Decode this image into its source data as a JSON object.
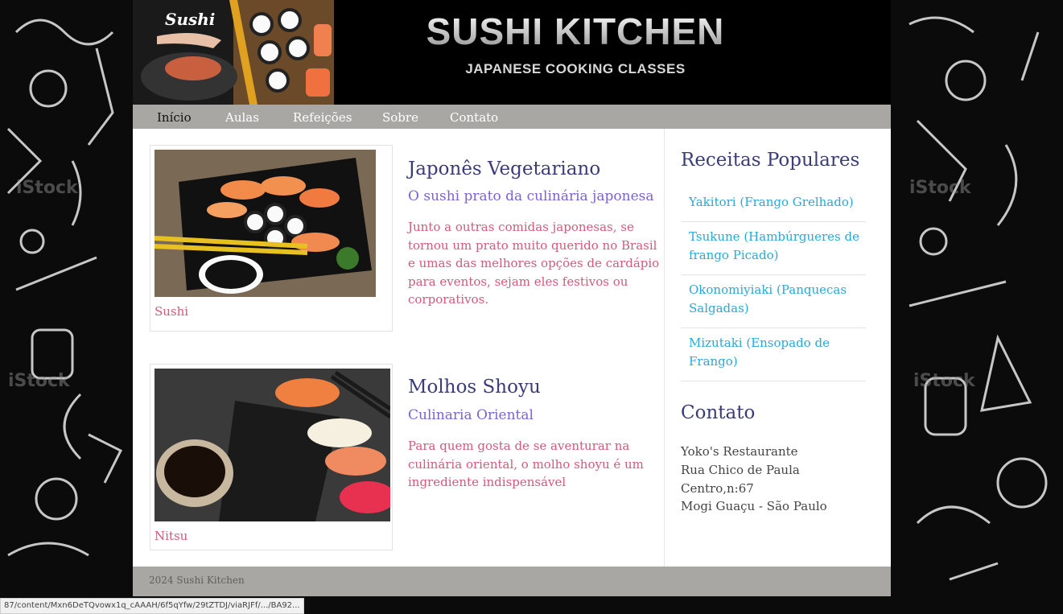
{
  "header": {
    "logo_text": "Sushi",
    "title": "SUSHI KITCHEN",
    "subtitle": "JAPANESE COOKING CLASSES"
  },
  "nav": {
    "items": [
      {
        "label": "Início",
        "active": true
      },
      {
        "label": "Aulas",
        "active": false
      },
      {
        "label": "Refeições",
        "active": false
      },
      {
        "label": "Sobre",
        "active": false
      },
      {
        "label": "Contato",
        "active": false
      }
    ]
  },
  "articles": [
    {
      "caption": "Sushi",
      "title": "Japonês Vegetariano",
      "subtitle": "O sushi prato da culinária japonesa",
      "body": "Junto a outras comidas japonesas, se tornou um prato muito querido no Brasil e umas das melhores opções de cardápio para eventos, sejam eles festivos ou corporativos."
    },
    {
      "caption": "Nitsu",
      "title": "Molhos Shoyu",
      "subtitle": "Culinaria Oriental",
      "body": "Para quem gosta de se aventurar na culinária oriental, o molho shoyu é um ingrediente indispensável"
    }
  ],
  "sidebar": {
    "popular_title": "Receitas Populares",
    "recipes": [
      "Yakitori (Frango Grelhado)",
      "Tsukune (Hambúrgueres de frango Picado)",
      "Okonomiyiaki (Panquecas Salgadas)",
      "Mizutaki (Ensopado de Frango)"
    ],
    "contact_title": "Contato",
    "contact_lines": [
      "Yoko's Restaurante",
      "Rua Chico de Paula",
      "Centro,n:67",
      "Mogi Guaçu - São Paulo"
    ]
  },
  "footer": {
    "text": "2024 Sushi Kitchen"
  },
  "status_url": "87/content/Mxn6DeTQvowx1q_cAAAH/6f5qYfw/29tZTDJ/viaRJFf/.../BA92..."
}
